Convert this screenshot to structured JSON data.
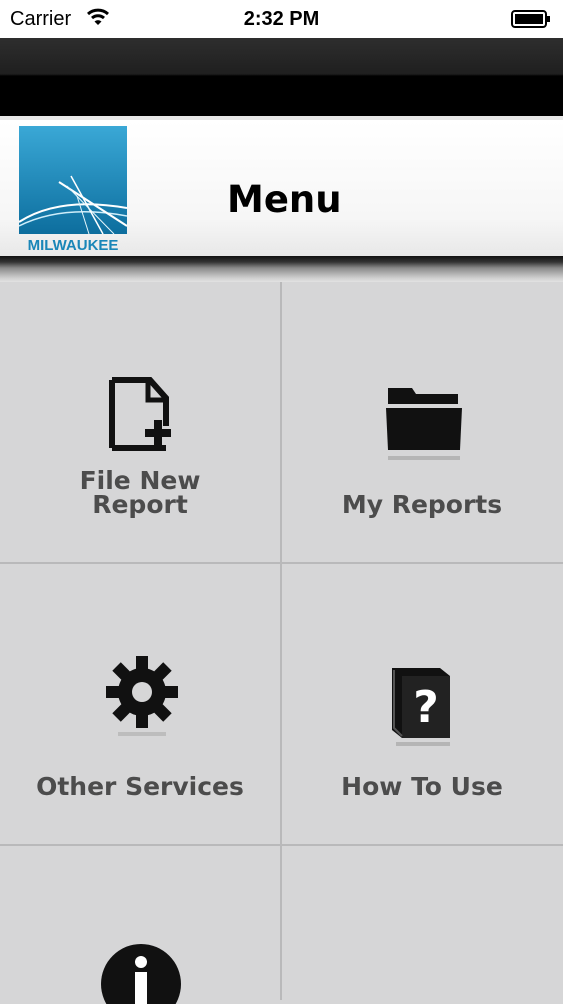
{
  "status_bar": {
    "carrier": "Carrier",
    "time": "2:32 PM"
  },
  "header": {
    "title": "Menu",
    "logo_text": "MILWAUKEE"
  },
  "menu": {
    "items": [
      {
        "label_line1": "File New",
        "label_line2": "Report",
        "icon": "file-add-icon"
      },
      {
        "label": "My Reports",
        "icon": "folder-icon"
      },
      {
        "label": "Other Services",
        "icon": "gear-icon"
      },
      {
        "label": "How To Use",
        "icon": "help-book-icon"
      },
      {
        "label": "",
        "icon": "info-icon"
      },
      {
        "label": "",
        "icon": ""
      }
    ]
  },
  "colors": {
    "tile_bg": "#d6d6d7",
    "label": "#4c4c4c",
    "logo_blue": "#1e8fbf"
  }
}
